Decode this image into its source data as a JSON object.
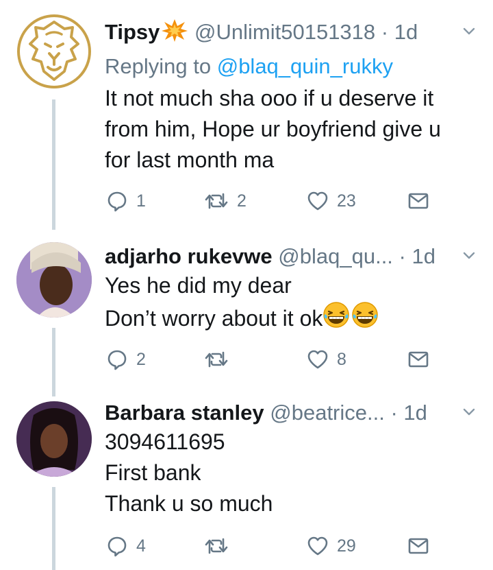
{
  "tweets": [
    {
      "name": "Tipsy",
      "handle": "@Unlimit50151318",
      "dot": "·",
      "time": "1d",
      "reply_prefix": "Replying to",
      "reply_mention": "@blaq_quin_rukky",
      "lines": [
        "It not much sha ooo if u deserve it",
        "from him, Hope ur boyfriend give u",
        "for last month ma"
      ],
      "replies": "1",
      "retweets": "2",
      "likes": "23",
      "avatar_icon": "lion-logo-icon"
    },
    {
      "name": "adjarho rukevwe",
      "handle": "@blaq_qu...",
      "dot": "·",
      "time": "1d",
      "lines": [
        "Yes he did my dear",
        "Don’t worry about it ok"
      ],
      "replies": "2",
      "retweets": "",
      "likes": "8",
      "emoji": "grinning-squinting-face-icon"
    },
    {
      "name": "Barbara stanley",
      "handle": "@beatrice...",
      "dot": "·",
      "time": "1d",
      "lines": [
        "3094611695",
        "First bank",
        "Thank u so much"
      ],
      "replies": "4",
      "retweets": "",
      "likes": "29"
    }
  ],
  "colors": {
    "text": "#14171a",
    "muted": "#657786",
    "link": "#1da1f2",
    "thread_line": "#ccd6dd",
    "lion_gold": "#c9a24a"
  }
}
